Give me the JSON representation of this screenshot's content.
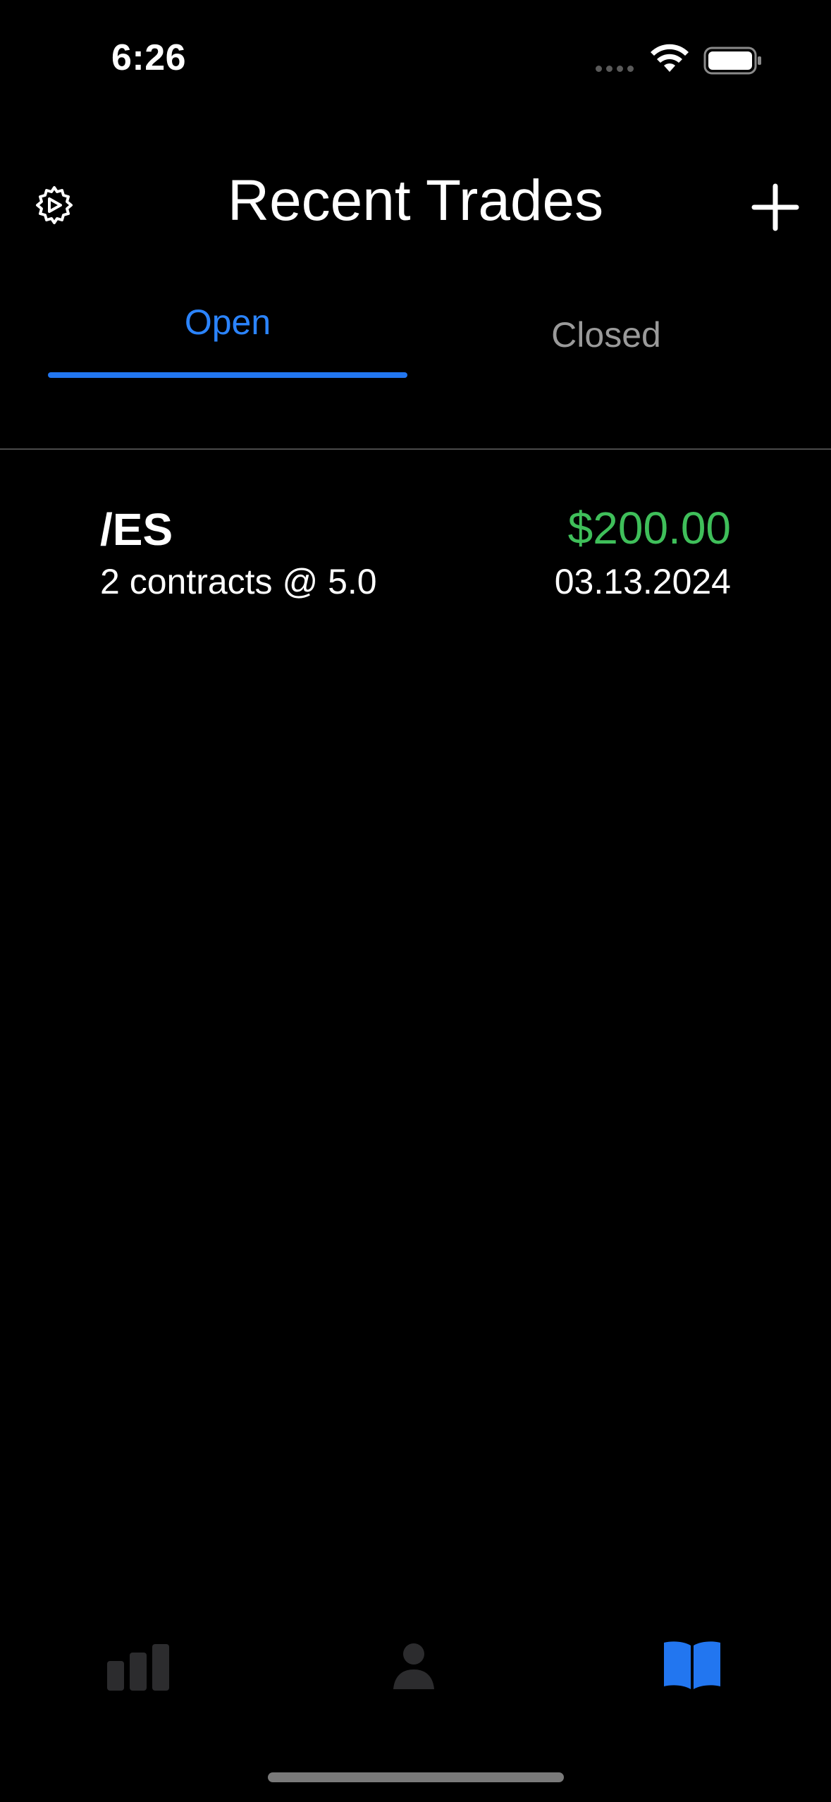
{
  "status_bar": {
    "time": "6:26",
    "icons": [
      "signal-dots-icon",
      "wifi-icon",
      "battery-icon"
    ]
  },
  "header": {
    "title": "Recent Trades",
    "left_icon": "gear-icon",
    "right_icon": "plus-icon"
  },
  "tabs": [
    {
      "label": "Open",
      "active": true
    },
    {
      "label": "Closed",
      "active": false
    }
  ],
  "trades": [
    {
      "symbol": "/ES",
      "detail": "2 contracts @ 5.0",
      "amount": "$200.00",
      "date": "03.13.2024"
    }
  ],
  "tab_bar": {
    "items": [
      {
        "icon": "bar-chart-icon",
        "active": false
      },
      {
        "icon": "person-icon",
        "active": false
      },
      {
        "icon": "book-icon",
        "active": true
      }
    ]
  },
  "colors": {
    "accent": "#2276f0",
    "positive": "#3fbf5a",
    "inactive": "#9a9a9a",
    "background": "#000000"
  }
}
